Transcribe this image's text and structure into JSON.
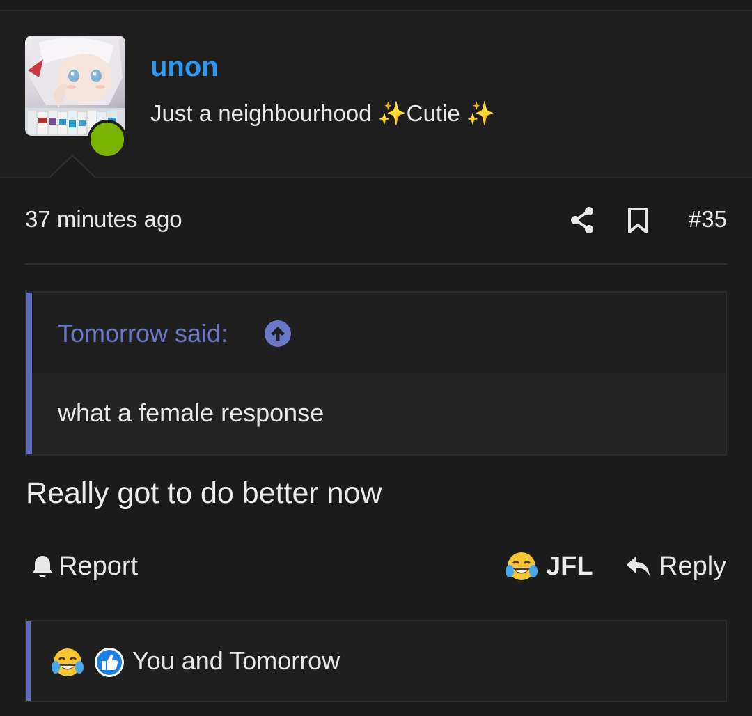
{
  "user": {
    "name": "unon",
    "title": "Just a neighbourhood ✨Cutie ✨",
    "online": true
  },
  "post": {
    "time": "37 minutes ago",
    "number": "#35",
    "body": "Really got to do better now"
  },
  "quote": {
    "author_label": "Tomorrow said:",
    "text": "what a female response"
  },
  "actions": {
    "report_label": "Report",
    "react_label": "JFL",
    "reply_label": "Reply"
  },
  "reactions": {
    "summary": "You and Tomorrow",
    "icons": [
      "laugh-cry-emoji-icon",
      "thumbs-up-icon"
    ]
  },
  "colors": {
    "username": "#2f98f0",
    "accent": "#5c6bc0",
    "online": "#79b500",
    "background": "#1b1b1c"
  }
}
